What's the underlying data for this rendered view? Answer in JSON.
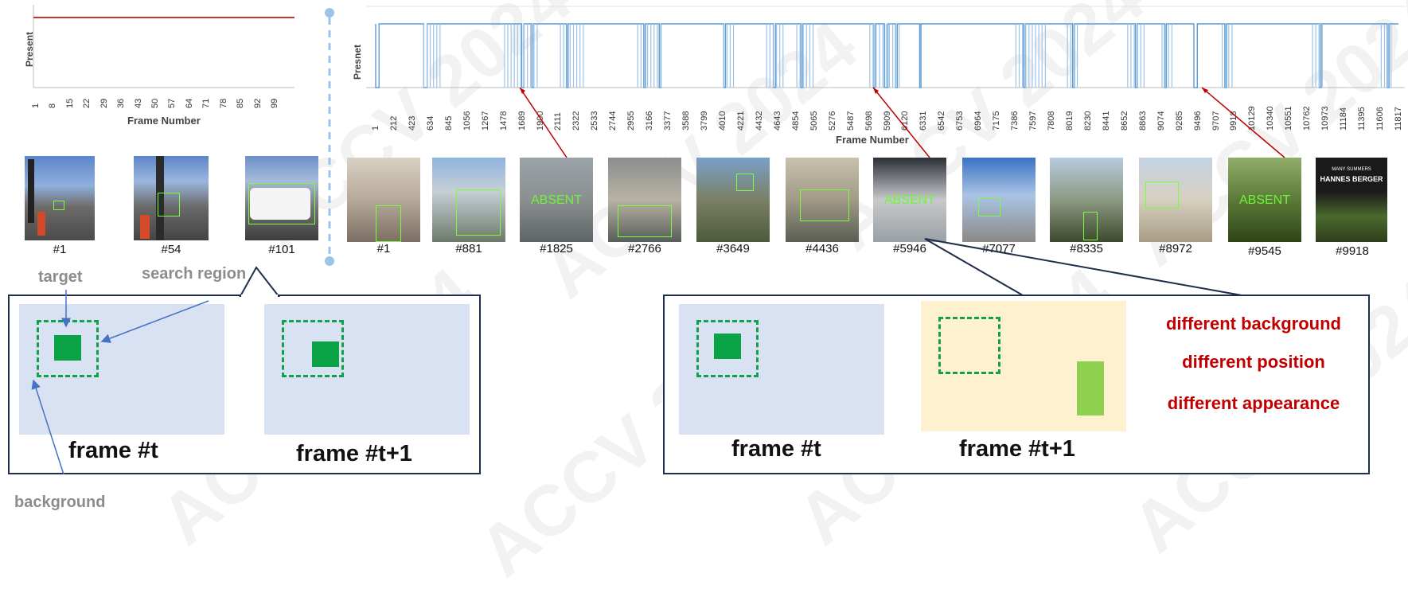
{
  "left_chart": {
    "ylabel": "Present",
    "xlabel": "Frame Number",
    "ticks": [
      "1",
      "8",
      "15",
      "22",
      "29",
      "36",
      "43",
      "50",
      "57",
      "64",
      "71",
      "78",
      "85",
      "92",
      "99"
    ]
  },
  "right_chart": {
    "ylabel": "Presnet",
    "xlabel": "Frame Number",
    "ticks": [
      "1",
      "212",
      "423",
      "634",
      "845",
      "1056",
      "1267",
      "1478",
      "1689",
      "1900",
      "2111",
      "2322",
      "2533",
      "2744",
      "2955",
      "3166",
      "3377",
      "3588",
      "3799",
      "4010",
      "4221",
      "4432",
      "4643",
      "4854",
      "5065",
      "5276",
      "5487",
      "5698",
      "5909",
      "6120",
      "6331",
      "6542",
      "6753",
      "6964",
      "7175",
      "7386",
      "7597",
      "7808",
      "8019",
      "8230",
      "8441",
      "8652",
      "8863",
      "9074",
      "9285",
      "9496",
      "9707",
      "9918",
      "10129",
      "10340",
      "10551",
      "10762",
      "10973",
      "11184",
      "11395",
      "11606",
      "11817"
    ]
  },
  "chart_data": [
    {
      "type": "line",
      "ylabel": "Present",
      "xlabel": "Frame Number",
      "x_range": [
        1,
        101
      ],
      "series": [
        {
          "values_description_free": true,
          "x": [
            1,
            101
          ],
          "y": [
            1,
            1
          ]
        }
      ],
      "color": "#c0392b"
    },
    {
      "type": "line",
      "ylabel": "Presnet",
      "xlabel": "Frame Number",
      "x_range": [
        1,
        11900
      ],
      "color": "#5b9bd5",
      "absent_intervals": [
        [
          1,
          40
        ],
        [
          560,
          600
        ],
        [
          1700,
          1725
        ],
        [
          1820,
          1840
        ],
        [
          2220,
          2240
        ],
        [
          3120,
          3140
        ],
        [
          3300,
          3320
        ],
        [
          4050,
          4070
        ],
        [
          4630,
          4655
        ],
        [
          4950,
          4970
        ],
        [
          5790,
          5810
        ],
        [
          5920,
          5960
        ],
        [
          6050,
          6070
        ],
        [
          6330,
          6345
        ],
        [
          7540,
          7560
        ],
        [
          8110,
          8130
        ],
        [
          8840,
          8860
        ],
        [
          9180,
          9200
        ],
        [
          9520,
          9560
        ],
        [
          9880,
          9900
        ],
        [
          10980,
          11000
        ],
        [
          11770,
          11790
        ]
      ]
    }
  ],
  "left_frames": [
    {
      "label": "#1"
    },
    {
      "label": "#54"
    },
    {
      "label": "#101"
    }
  ],
  "right_frames": [
    {
      "label": "#1",
      "absent": ""
    },
    {
      "label": "#881",
      "absent": ""
    },
    {
      "label": "#1825",
      "absent": "ABSENT"
    },
    {
      "label": "#2766",
      "absent": ""
    },
    {
      "label": "#3649",
      "absent": ""
    },
    {
      "label": "#4436",
      "absent": ""
    },
    {
      "label": "#5946",
      "absent": "ABSENT"
    },
    {
      "label": "#7077",
      "absent": ""
    },
    {
      "label": "#8335",
      "absent": ""
    },
    {
      "label": "#8972",
      "absent": ""
    },
    {
      "label": "#9545",
      "absent": "ABSENT"
    },
    {
      "label": "#9918",
      "absent": "",
      "poster_line1": "MANY SUMMERS",
      "poster_line2": "HANNES BERGER"
    }
  ],
  "left_diagram": {
    "target": "target",
    "search_region": "search region",
    "background": "background",
    "frame_t": "frame #t",
    "frame_t1": "frame #t+1"
  },
  "right_diagram": {
    "frame_t": "frame #t",
    "frame_t1": "frame #t+1",
    "diff_background": "different background",
    "diff_position": "different position",
    "diff_appearance": "different appearance"
  },
  "watermark": "ACCV 2024",
  "colors": {
    "panel_blue": "#d9e2f2",
    "panel_yellow": "#fdf1d0",
    "target_green": "#0aa346",
    "appearance_green": "#8fd14f",
    "label_red": "#c00000",
    "callout_border": "#1f2e4c"
  }
}
